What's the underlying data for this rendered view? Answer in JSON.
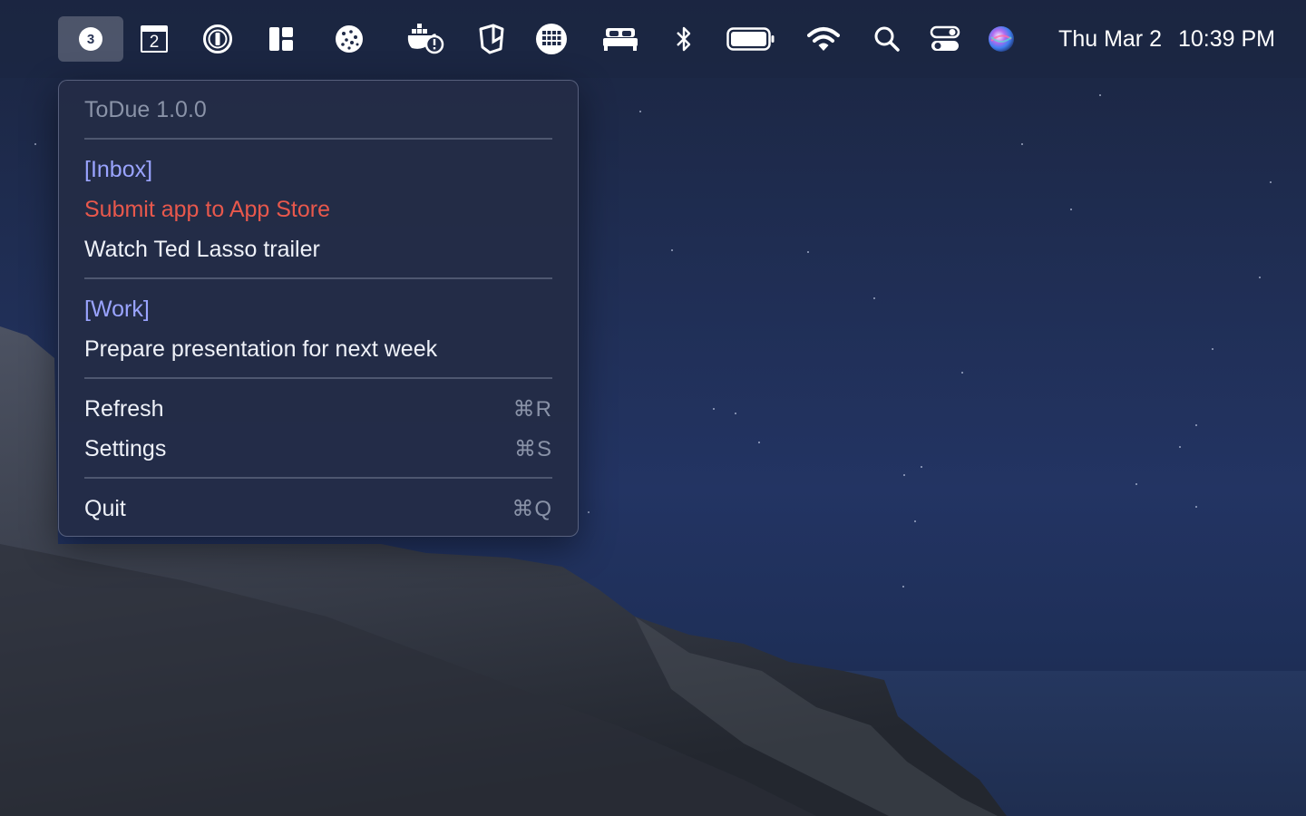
{
  "menubar": {
    "todue_badge": "3",
    "calendar_day": "2",
    "icons": [
      "todue-badge-icon",
      "calendar-icon",
      "1password-icon",
      "layout-icon",
      "cookie-icon",
      "docker-icon",
      "shortcuts-icon",
      "grid-globe-icon",
      "bed-icon",
      "bluetooth-icon",
      "battery-icon",
      "wifi-icon",
      "spotlight-search-icon",
      "control-center-icon",
      "siri-icon"
    ],
    "date": "Thu Mar 2",
    "time": "10:39 PM"
  },
  "menu": {
    "app_version": "ToDue 1.0.0",
    "sections": [
      {
        "name": "[Inbox]",
        "tasks": [
          "Submit app to App Store",
          "Watch Ted Lasso trailer"
        ]
      },
      {
        "name": "[Work]",
        "tasks": [
          "Prepare presentation for next week"
        ]
      }
    ],
    "actions": {
      "refresh": {
        "label": "Refresh",
        "shortcut": "⌘R"
      },
      "settings": {
        "label": "Settings",
        "shortcut": "⌘S"
      },
      "quit": {
        "label": "Quit",
        "shortcut": "⌘Q"
      }
    }
  },
  "colors": {
    "section": "#9aa4ff",
    "overdue": "#e8584c",
    "text": "#eef1f8",
    "muted": "#8a93a8"
  }
}
